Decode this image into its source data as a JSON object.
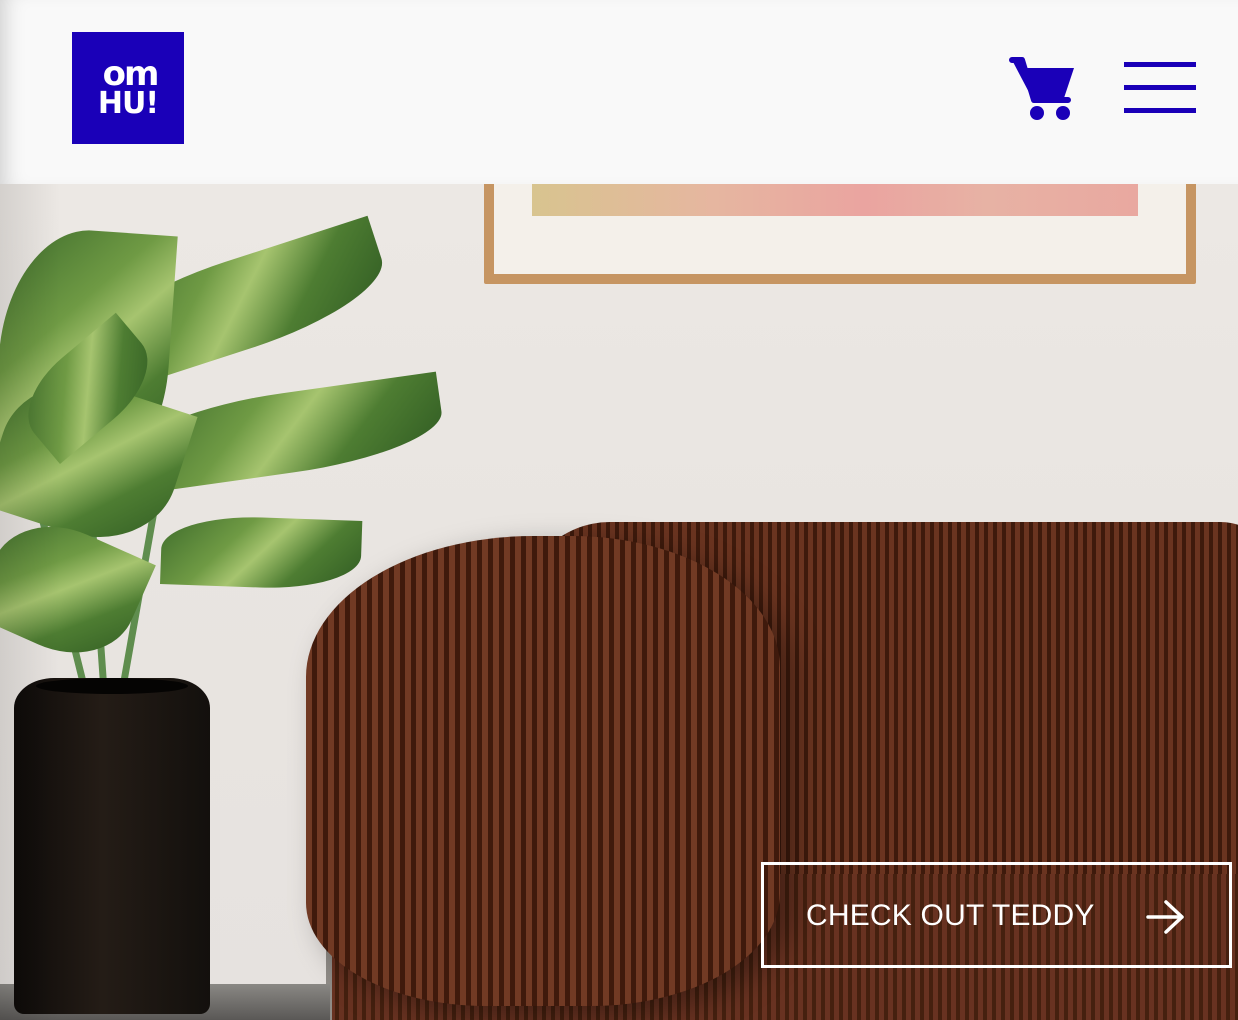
{
  "header": {
    "logo": {
      "line1": "om",
      "line2": "HU!"
    },
    "cart_icon": "shopping-cart-icon",
    "menu_icon": "hamburger-menu-icon"
  },
  "hero": {
    "cta_label": "CHECK OUT TEDDY",
    "cta_icon": "arrow-right-icon"
  },
  "colors": {
    "brand": "#1a00b8",
    "background": "#f9f9f9",
    "cta_text": "#ffffff"
  }
}
